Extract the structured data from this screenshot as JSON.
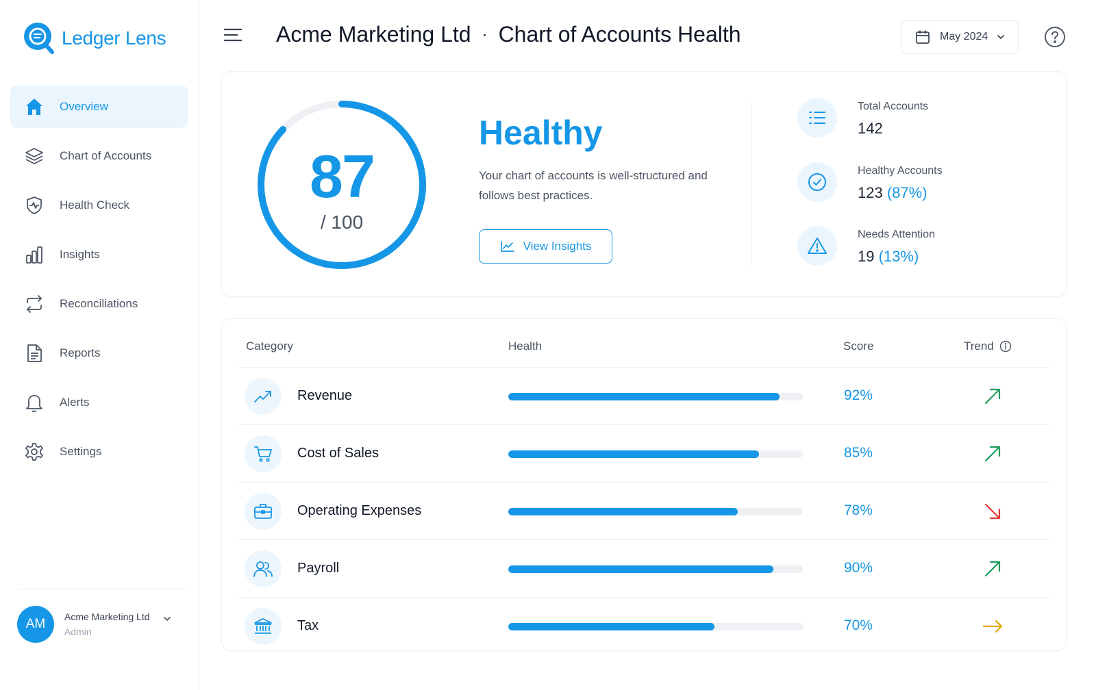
{
  "app": {
    "name": "Ledger Lens"
  },
  "colors": {
    "accent": "#1596e6",
    "trend_up": "#1a9e5a",
    "trend_down": "#e53935",
    "trend_flat": "#e8a500"
  },
  "sidebar": {
    "items": [
      {
        "label": "Overview",
        "icon": "home-icon",
        "active": true
      },
      {
        "label": "Chart of Accounts",
        "icon": "layers-icon"
      },
      {
        "label": "Health Check",
        "icon": "shield-pulse-icon"
      },
      {
        "label": "Insights",
        "icon": "bar-chart-icon"
      },
      {
        "label": "Reconciliations",
        "icon": "arrows-swap-icon"
      },
      {
        "label": "Reports",
        "icon": "document-icon"
      },
      {
        "label": "Alerts",
        "icon": "bell-icon"
      },
      {
        "label": "Settings",
        "icon": "gear-icon"
      }
    ]
  },
  "account": {
    "initials": "AM",
    "name": "Acme Marketing Ltd",
    "role": "Admin"
  },
  "header": {
    "company": "Acme Marketing Ltd",
    "separator": "·",
    "title": "Chart of Accounts Health",
    "date": "May 2024"
  },
  "score": {
    "value": "87",
    "out_of": "/ 100",
    "fraction": 0.87,
    "status": "Healthy",
    "description": "Your chart of accounts is well-structured and follows best practices.",
    "button": "View Insights"
  },
  "stats": {
    "total": {
      "label": "Total Accounts",
      "value": "142"
    },
    "healthy": {
      "label": "Healthy Accounts",
      "value": "123",
      "pct": "(87%)"
    },
    "attention": {
      "label": "Needs Attention",
      "value": "19",
      "pct": "(13%)"
    }
  },
  "table": {
    "columns": {
      "category": "Category",
      "health": "Health",
      "score": "Score",
      "trend": "Trend"
    },
    "rows": [
      {
        "name": "Revenue",
        "icon": "trending-up-icon",
        "health": 0.92,
        "score": "92%",
        "trend": "up"
      },
      {
        "name": "Cost of Sales",
        "icon": "cart-icon",
        "health": 0.85,
        "score": "85%",
        "trend": "up"
      },
      {
        "name": "Operating Expenses",
        "icon": "briefcase-icon",
        "health": 0.78,
        "score": "78%",
        "trend": "down"
      },
      {
        "name": "Payroll",
        "icon": "users-icon",
        "health": 0.9,
        "score": "90%",
        "trend": "up"
      },
      {
        "name": "Tax",
        "icon": "bank-icon",
        "health": 0.7,
        "score": "70%",
        "trend": "flat"
      }
    ]
  }
}
